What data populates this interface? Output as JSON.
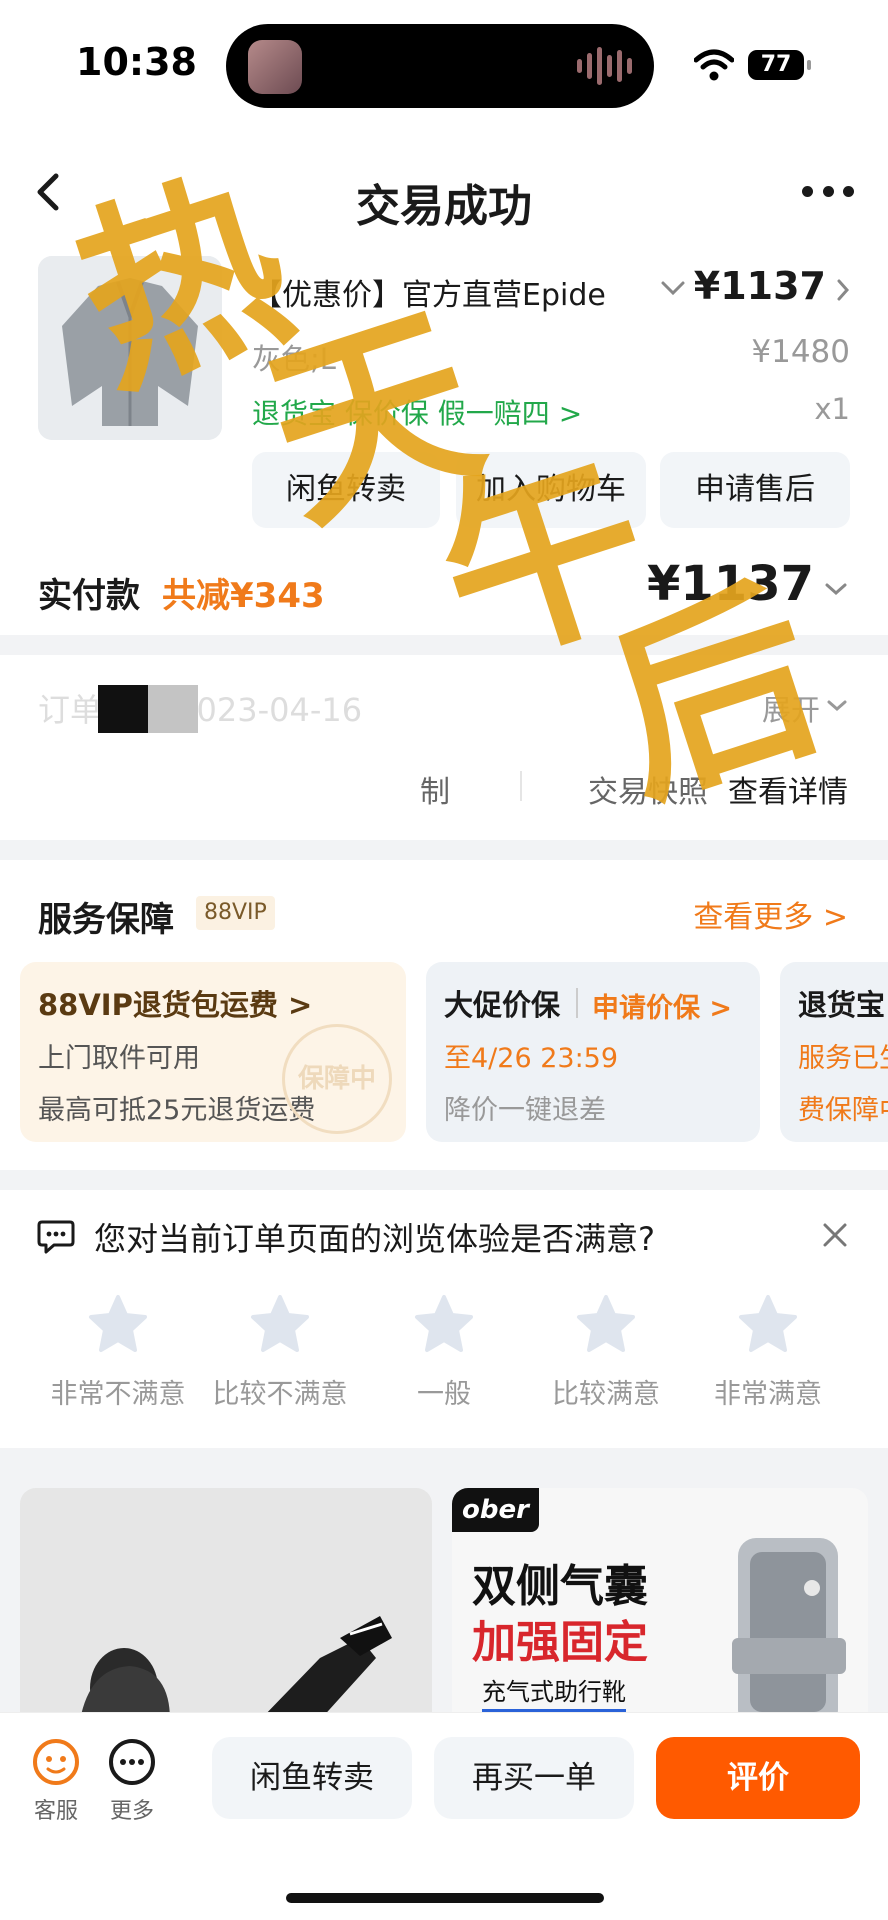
{
  "status_bar": {
    "time": "10:38",
    "battery": "77"
  },
  "nav": {
    "title": "交易成功"
  },
  "product": {
    "title": "【优惠价】官方直营Epide",
    "price": "¥1137",
    "sku": "灰色;L",
    "original_price": "¥1480",
    "service": "退货宝 保价保 假一赔四 >",
    "quantity": "x1",
    "buttons": [
      "闲鱼转卖",
      "加入购物车",
      "申请售后"
    ]
  },
  "payment": {
    "label": "实付款",
    "reduction": "共减¥343",
    "amount": "¥1137"
  },
  "order_info": {
    "label": "订单信息 2023-04-16",
    "expand": "展开",
    "control": "制",
    "snapshot": "交易快照",
    "detail": "查看详情"
  },
  "guarantee": {
    "title": "服务保障",
    "vip": "88VIP",
    "more": "查看更多 >",
    "cards": [
      {
        "title": "88VIP退货包运费 >",
        "line1": "上门取件可用",
        "line2": "最高可抵25元退货运费",
        "stamp": "保障中"
      },
      {
        "title": "大促价保",
        "action": "申请价保 >",
        "line1": "至4/26 23:59",
        "line2": "降价一键退差"
      },
      {
        "title": "退货宝",
        "line1": "服务已生",
        "line2": "费保障中"
      }
    ]
  },
  "survey": {
    "question": "您对当前订单页面的浏览体验是否满意?",
    "options": [
      "非常不满意",
      "比较不满意",
      "一般",
      "比较满意",
      "非常满意"
    ]
  },
  "ads": {
    "right": {
      "brand": "ober",
      "headline1": "双侧气囊",
      "headline2": "加强固定",
      "subline": "充气式助行靴"
    }
  },
  "bottom_bar": {
    "service_label": "客服",
    "more_label": "更多",
    "resell": "闲鱼转卖",
    "rebuy": "再买一单",
    "review": "评价"
  },
  "watermark": {
    "text": [
      "热",
      "天",
      "午",
      "后"
    ]
  },
  "colors": {
    "accent": "#ff5a00",
    "orange_text": "#f07a1a",
    "green_service": "#22a84a",
    "watermark": "#e4a41d"
  }
}
